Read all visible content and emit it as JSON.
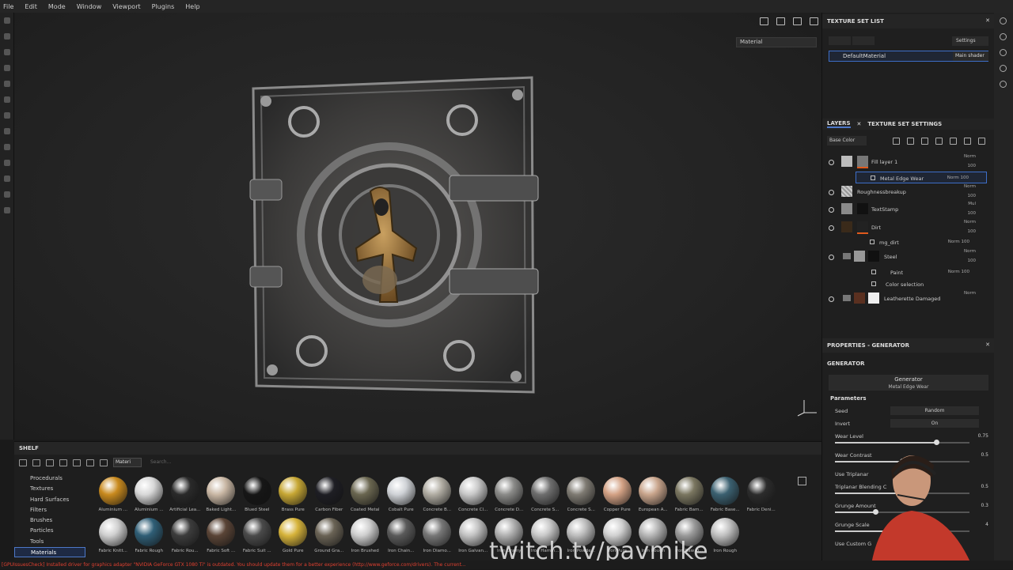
{
  "menu": [
    "File",
    "Edit",
    "Mode",
    "Window",
    "Viewport",
    "Plugins",
    "Help"
  ],
  "viewport": {
    "material_dropdown": "Material"
  },
  "texture_set_list": {
    "title": "TEXTURE SET LIST",
    "settings": "Settings",
    "set_name": "DefaultMaterial",
    "shader": "Main shader"
  },
  "layers_panel": {
    "tab_layers": "LAYERS",
    "tab_settings": "TEXTURE SET SETTINGS",
    "channel": "Base Color",
    "layers": [
      {
        "name": "Fill layer 1",
        "blend": "Norm",
        "opacity": "100",
        "thumb": "#bcbcbc"
      },
      {
        "name": "Roughnessbreakup",
        "blend": "Norm",
        "opacity": "100",
        "thumb": "#999"
      },
      {
        "name": "TextStamp",
        "blend": "Mul",
        "opacity": "100",
        "thumb": "#8a8a8a"
      },
      {
        "name": "Dirt",
        "blend": "Norm",
        "opacity": "100",
        "thumb": "#3a2a1a"
      },
      {
        "name": "Steel",
        "blend": "Norm",
        "opacity": "100",
        "thumb": "#999"
      },
      {
        "name": "Leatherette Damaged",
        "blend": "Norm",
        "opacity": "",
        "thumb": "#5a3020"
      }
    ],
    "sublayers": {
      "metal_edge_wear": {
        "name": "Metal Edge Wear",
        "blend": "Norm",
        "opacity": "100"
      },
      "mg_dirt": {
        "name": "mg_dirt",
        "blend": "Norm",
        "opacity": "100"
      },
      "paint": {
        "name": "Paint",
        "blend": "Norm",
        "opacity": "100"
      },
      "color_selection": {
        "name": "Color selection"
      }
    }
  },
  "properties": {
    "title": "PROPERTIES - GENERATOR",
    "section": "GENERATOR",
    "generator_label": "Generator",
    "generator_name": "Metal Edge Wear",
    "parameters_label": "Parameters",
    "params": [
      {
        "label": "Seed",
        "value": "Random"
      },
      {
        "label": "Invert",
        "value": "On"
      },
      {
        "label": "Wear Level",
        "value": "0.75",
        "level": 0.75
      },
      {
        "label": "Wear Contrast",
        "value": "0.5",
        "level": 0.5
      },
      {
        "label": "Use Triplanar",
        "value": ""
      },
      {
        "label": "Triplanar Blending C",
        "value": "0.5",
        "level": 0.5
      },
      {
        "label": "Grunge Amount",
        "value": "0.3",
        "level": 0.3
      },
      {
        "label": "Grunge Scale",
        "value": "4",
        "level": 0.4
      },
      {
        "label": "Use Custom G",
        "value": ""
      }
    ]
  },
  "shelf": {
    "title": "SHELF",
    "filter_tag": "Materi",
    "search_placeholder": "Search...",
    "categories": [
      "Procedurals",
      "Textures",
      "Hard Surfaces",
      "Filters",
      "Brushes",
      "Particles",
      "Tools",
      "Materials"
    ],
    "selected_category": "Materials",
    "materials": [
      {
        "name": "Aluminium ...",
        "color": "#c98a1e"
      },
      {
        "name": "Aluminium ...",
        "color": "#d8d8d8"
      },
      {
        "name": "Artificial Lea...",
        "color": "#2a2a2a"
      },
      {
        "name": "Baked Light...",
        "color": "#c9b7a4"
      },
      {
        "name": "Blued Steel",
        "color": "#161616"
      },
      {
        "name": "Brass Pure",
        "color": "#c7a734"
      },
      {
        "name": "Carbon Fiber",
        "color": "#1e1e24"
      },
      {
        "name": "Coated Metal",
        "color": "#6a6650"
      },
      {
        "name": "Cobalt Pure",
        "color": "#cfd2d6"
      },
      {
        "name": "Concrete B...",
        "color": "#b0aca2"
      },
      {
        "name": "Concrete Cl...",
        "color": "#c8c8c8"
      },
      {
        "name": "Concrete D...",
        "color": "#8a8a88"
      },
      {
        "name": "Concrete S...",
        "color": "#6e6e6e"
      },
      {
        "name": "Concrete S...",
        "color": "#7e7a72"
      },
      {
        "name": "Copper Pure",
        "color": "#d3a184"
      },
      {
        "name": "European A...",
        "color": "#c9a58c"
      },
      {
        "name": "Fabric Bam...",
        "color": "#7a7660"
      },
      {
        "name": "Fabric Base...",
        "color": "#3b6070"
      },
      {
        "name": "Fabric Deni...",
        "color": "#2c2c2c"
      },
      {
        "name": "Fabric Knitt...",
        "color": "#cfcfcf"
      },
      {
        "name": "Fabric Rough",
        "color": "#2f5e76"
      },
      {
        "name": "Fabric Rou...",
        "color": "#3c3c3c"
      },
      {
        "name": "Fabric Soft ...",
        "color": "#5a4436"
      },
      {
        "name": "Fabric Suit ...",
        "color": "#4a4a4a"
      },
      {
        "name": "Gold Pure",
        "color": "#d6b33a"
      },
      {
        "name": "Ground Gra...",
        "color": "#6a6355"
      },
      {
        "name": "Iron Brushed",
        "color": "#cfcfcf"
      },
      {
        "name": "Iron Chain...",
        "color": "#5a5a5a"
      },
      {
        "name": "Iron Diamo...",
        "color": "#777"
      },
      {
        "name": "Iron Galvan...",
        "color": "#c2c2c2"
      },
      {
        "name": "Iron Grainy",
        "color": "#b0b0b0"
      },
      {
        "name": "Iron Hamm...",
        "color": "#c8c8c8"
      },
      {
        "name": "Iron Powde...",
        "color": "#bcbcbc"
      },
      {
        "name": "Iron Pure",
        "color": "#d0d0d0"
      },
      {
        "name": "Iron Rough",
        "color": "#b5b5b5"
      },
      {
        "name": "Iron Raw D...",
        "color": "#9a9a9a"
      },
      {
        "name": "Iron Rough",
        "color": "#c0c0c0"
      }
    ]
  },
  "status_bar": "[GPUIssuesCheck] Installed driver for graphics adapter \"NVIDIA GeForce GTX 1080 Ti\" is outdated. You should update them for a better experience (http://www.geforce.com/drivers). The current...",
  "watermark": "twitch.tv/pavmike",
  "colors": {
    "accent": "#4d78c8",
    "warning": "#e04030",
    "paint_bar": "#e05a1c"
  }
}
